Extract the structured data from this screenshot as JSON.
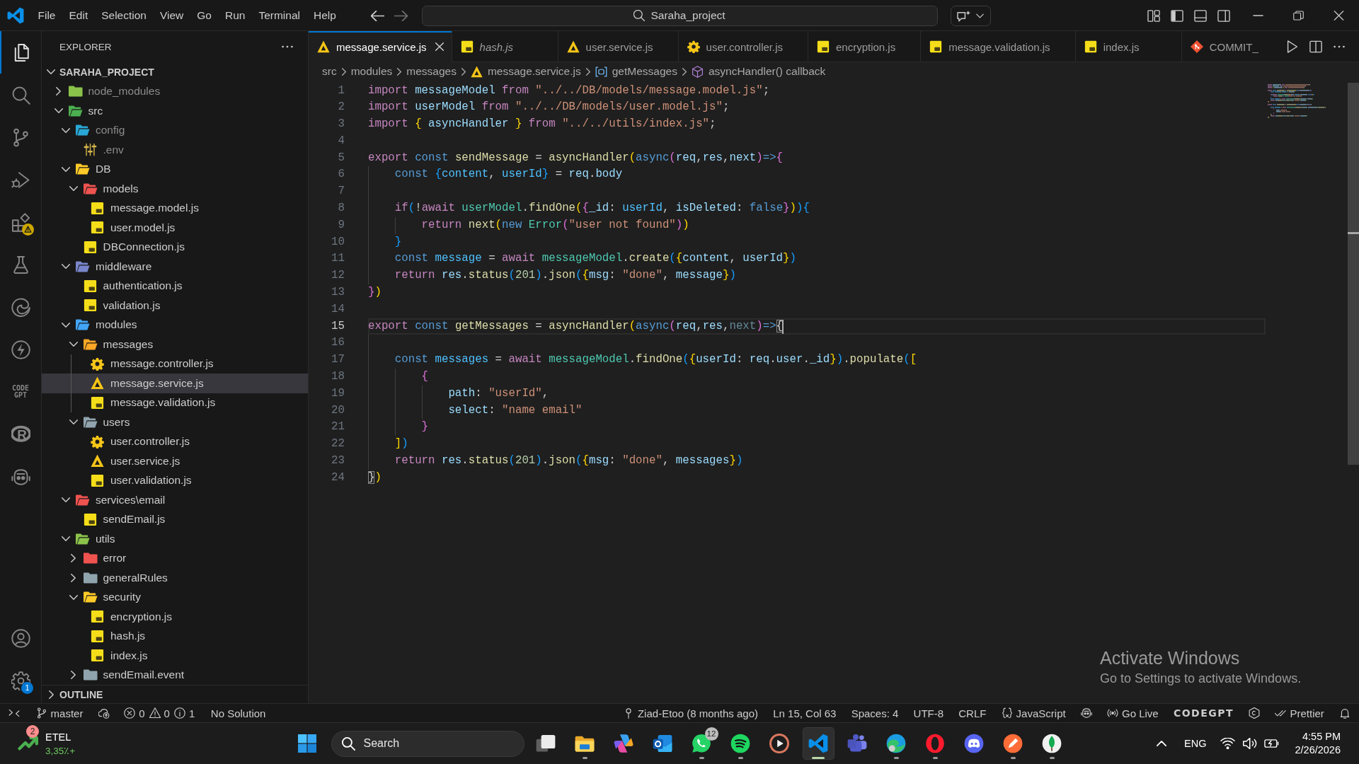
{
  "title_bar": {
    "menu": [
      "File",
      "Edit",
      "Selection",
      "View",
      "Go",
      "Run",
      "Terminal",
      "Help"
    ],
    "command_center": "Saraha_project"
  },
  "activity_bar": {
    "items": [
      {
        "kind": "explorer",
        "selected": true,
        "warning": false
      },
      {
        "kind": "search",
        "selected": false,
        "warning": false
      },
      {
        "kind": "source-control",
        "selected": false,
        "warning": false
      },
      {
        "kind": "debug",
        "selected": false,
        "warning": false
      },
      {
        "kind": "extensions",
        "selected": false,
        "warning": true
      },
      {
        "kind": "testing",
        "selected": false,
        "warning": false
      },
      {
        "kind": "browser",
        "selected": false,
        "warning": false
      },
      {
        "kind": "lightning",
        "selected": false,
        "warning": false
      },
      {
        "kind": "text",
        "label": "CODE GPT",
        "selected": false,
        "warning": false
      },
      {
        "kind": "ring",
        "label": "R",
        "selected": false,
        "warning": false
      },
      {
        "kind": "robot",
        "selected": false,
        "warning": false
      }
    ],
    "bottom": [
      {
        "kind": "account"
      },
      {
        "kind": "settings",
        "badge": "1"
      }
    ]
  },
  "sidebar": {
    "title": "EXPLORER",
    "project": {
      "name": "SARAHA_PROJECT",
      "expanded": true,
      "children": [
        {
          "name": "node_modules",
          "kind": "folder",
          "color": "#8bc34a",
          "expanded": false,
          "dimmed": true,
          "selected": false
        },
        {
          "name": "src",
          "kind": "folder",
          "color": "#4caf50",
          "expanded": true,
          "dimmed": false,
          "selected": false,
          "children": [
            {
              "name": "config",
              "kind": "folder",
              "color": "#29a8d6",
              "expanded": true,
              "dimmed": true,
              "selected": false,
              "children": [
                {
                  "name": ".env",
                  "kind": "env",
                  "dimmed": true,
                  "selected": false
                }
              ]
            },
            {
              "name": "DB",
              "kind": "folder",
              "color": "#ffca28",
              "expanded": true,
              "dimmed": false,
              "selected": false,
              "children": [
                {
                  "name": "models",
                  "kind": "folder",
                  "color": "#ef5350",
                  "expanded": true,
                  "dimmed": false,
                  "selected": false,
                  "children": [
                    {
                      "name": "message.model.js",
                      "kind": "js",
                      "dimmed": false,
                      "selected": false
                    },
                    {
                      "name": "user.model.js",
                      "kind": "js",
                      "dimmed": false,
                      "selected": false
                    }
                  ]
                },
                {
                  "name": "DBConnection.js",
                  "kind": "js",
                  "dimmed": false,
                  "selected": false
                }
              ]
            },
            {
              "name": "middleware",
              "kind": "folder",
              "color": "#7986cb",
              "expanded": true,
              "dimmed": false,
              "selected": false,
              "children": [
                {
                  "name": "authentication.js",
                  "kind": "js",
                  "dimmed": false,
                  "selected": false
                },
                {
                  "name": "validation.js",
                  "kind": "js",
                  "dimmed": false,
                  "selected": false
                }
              ]
            },
            {
              "name": "modules",
              "kind": "folder",
              "color": "#42a5f5",
              "expanded": true,
              "dimmed": false,
              "selected": false,
              "children": [
                {
                  "name": "messages",
                  "kind": "folder",
                  "color": "#ffa726",
                  "expanded": true,
                  "dimmed": false,
                  "selected": false,
                  "children": [
                    {
                      "name": "message.controller.js",
                      "kind": "controller",
                      "dimmed": false,
                      "selected": false
                    },
                    {
                      "name": "message.service.js",
                      "kind": "service",
                      "dimmed": false,
                      "selected": true
                    },
                    {
                      "name": "message.validation.js",
                      "kind": "js",
                      "dimmed": false,
                      "selected": false
                    }
                  ]
                },
                {
                  "name": "users",
                  "kind": "folder",
                  "color": "#90a4ae",
                  "expanded": true,
                  "dimmed": false,
                  "selected": false,
                  "children": [
                    {
                      "name": "user.controller.js",
                      "kind": "controller",
                      "dimmed": false,
                      "selected": false
                    },
                    {
                      "name": "user.service.js",
                      "kind": "service",
                      "dimmed": false,
                      "selected": false
                    },
                    {
                      "name": "user.validation.js",
                      "kind": "js",
                      "dimmed": false,
                      "selected": false
                    }
                  ]
                }
              ]
            },
            {
              "name": "services\\email",
              "kind": "folder",
              "color": "#ef5350",
              "expanded": true,
              "dimmed": false,
              "selected": false,
              "children": [
                {
                  "name": "sendEmail.js",
                  "kind": "js",
                  "dimmed": false,
                  "selected": false
                }
              ]
            },
            {
              "name": "utils",
              "kind": "folder",
              "color": "#8bc34a",
              "expanded": true,
              "dimmed": false,
              "selected": false,
              "children": [
                {
                  "name": "error",
                  "kind": "folder",
                  "color": "#ef5350",
                  "expanded": false,
                  "dimmed": false,
                  "selected": false
                },
                {
                  "name": "generalRules",
                  "kind": "folder",
                  "color": "#90a4ae",
                  "expanded": false,
                  "dimmed": false,
                  "selected": false
                },
                {
                  "name": "security",
                  "kind": "folder",
                  "color": "#ffca28",
                  "expanded": true,
                  "dimmed": false,
                  "selected": false,
                  "children": [
                    {
                      "name": "encryption.js",
                      "kind": "js",
                      "dimmed": false,
                      "selected": false
                    },
                    {
                      "name": "hash.js",
                      "kind": "js",
                      "dimmed": false,
                      "selected": false
                    },
                    {
                      "name": "index.js",
                      "kind": "js",
                      "dimmed": false,
                      "selected": false
                    }
                  ]
                },
                {
                  "name": "sendEmail.event",
                  "kind": "folder",
                  "color": "#90a4ae",
                  "expanded": false,
                  "dimmed": false,
                  "selected": false
                }
              ]
            }
          ]
        }
      ]
    },
    "outline": {
      "title": "OUTLINE",
      "expanded": false
    }
  },
  "editor": {
    "tabs": [
      {
        "label": "message.service.js",
        "kind": "service",
        "selected": true,
        "preview": false
      },
      {
        "label": "hash.js",
        "kind": "js",
        "selected": false,
        "preview": true
      },
      {
        "label": "user.service.js",
        "kind": "service",
        "selected": false,
        "preview": false
      },
      {
        "label": "user.controller.js",
        "kind": "controller",
        "selected": false,
        "preview": false
      },
      {
        "label": "encryption.js",
        "kind": "js",
        "selected": false,
        "preview": false
      },
      {
        "label": "message.validation.js",
        "kind": "js",
        "selected": false,
        "preview": false
      },
      {
        "label": "index.js",
        "kind": "js",
        "selected": false,
        "preview": false
      },
      {
        "label": "COMMIT_",
        "kind": "git",
        "selected": false,
        "preview": false
      }
    ],
    "breadcrumbs": [
      {
        "text": "src",
        "kind": "folder"
      },
      {
        "text": "modules",
        "kind": "folder"
      },
      {
        "text": "messages",
        "kind": "folder"
      },
      {
        "text": "message.service.js",
        "kind": "service"
      },
      {
        "text": "getMessages",
        "kind": "variable"
      },
      {
        "text": "asyncHandler() callback",
        "kind": "method"
      }
    ],
    "lines": [
      {
        "number": "1",
        "active": false,
        "tokens": [
          {
            "text": "import ",
            "kind": "keyword"
          },
          {
            "text": "messageModel",
            "kind": "variable"
          },
          {
            "text": " from ",
            "kind": "keyword"
          },
          {
            "text": "\"../../DB/models/message.model.js\"",
            "kind": "string"
          },
          {
            "text": ";",
            "kind": "plain"
          }
        ]
      },
      {
        "number": "2",
        "active": false,
        "tokens": [
          {
            "text": "import ",
            "kind": "keyword"
          },
          {
            "text": "userModel",
            "kind": "variable"
          },
          {
            "text": " from ",
            "kind": "keyword"
          },
          {
            "text": "\"../../DB/models/user.model.js\"",
            "kind": "string"
          },
          {
            "text": ";",
            "kind": "plain"
          }
        ]
      },
      {
        "number": "3",
        "active": false,
        "tokens": [
          {
            "text": "import ",
            "kind": "keyword"
          },
          {
            "text": "{",
            "kind": "bracket1"
          },
          {
            "text": " asyncHandler ",
            "kind": "variable"
          },
          {
            "text": "}",
            "kind": "bracket1"
          },
          {
            "text": " from ",
            "kind": "keyword"
          },
          {
            "text": "\"../../utils/index.js\"",
            "kind": "string"
          },
          {
            "text": ";",
            "kind": "plain"
          }
        ]
      },
      {
        "number": "4",
        "active": false
      },
      {
        "number": "5",
        "active": false,
        "tokens": [
          {
            "text": "export ",
            "kind": "keyword"
          },
          {
            "text": "const ",
            "kind": "storage"
          },
          {
            "text": "sendMessage",
            "kind": "function"
          },
          {
            "text": " = ",
            "kind": "plain"
          },
          {
            "text": "asyncHandler",
            "kind": "function"
          },
          {
            "text": "(",
            "kind": "bracket1"
          },
          {
            "text": "async",
            "kind": "storage"
          },
          {
            "text": "(",
            "kind": "bracket2"
          },
          {
            "text": "req",
            "kind": "variable"
          },
          {
            "text": ",",
            "kind": "plain"
          },
          {
            "text": "res",
            "kind": "variable"
          },
          {
            "text": ",",
            "kind": "plain"
          },
          {
            "text": "next",
            "kind": "variable"
          },
          {
            "text": ")",
            "kind": "bracket2"
          },
          {
            "text": "=>",
            "kind": "storage"
          },
          {
            "text": "{",
            "kind": "bracket2"
          }
        ]
      },
      {
        "number": "6",
        "active": false,
        "tokens": [
          {
            "text": "    const ",
            "kind": "storage"
          },
          {
            "text": "{",
            "kind": "bracket3"
          },
          {
            "text": "content",
            "kind": "constant"
          },
          {
            "text": ", ",
            "kind": "plain"
          },
          {
            "text": "userId",
            "kind": "constant"
          },
          {
            "text": "}",
            "kind": "bracket3"
          },
          {
            "text": " = ",
            "kind": "plain"
          },
          {
            "text": "req",
            "kind": "variable"
          },
          {
            "text": ".",
            "kind": "plain"
          },
          {
            "text": "body",
            "kind": "variable"
          }
        ]
      },
      {
        "number": "7",
        "active": false
      },
      {
        "number": "8",
        "active": false,
        "tokens": [
          {
            "text": "    if",
            "kind": "keyword"
          },
          {
            "text": "(",
            "kind": "bracket3"
          },
          {
            "text": "!",
            "kind": "plain"
          },
          {
            "text": "await ",
            "kind": "keyword"
          },
          {
            "text": "userModel",
            "kind": "type"
          },
          {
            "text": ".",
            "kind": "plain"
          },
          {
            "text": "findOne",
            "kind": "function"
          },
          {
            "text": "(",
            "kind": "bracket1"
          },
          {
            "text": "{",
            "kind": "bracket2"
          },
          {
            "text": "_id",
            "kind": "variable"
          },
          {
            "text": ": ",
            "kind": "plain"
          },
          {
            "text": "userId",
            "kind": "constant"
          },
          {
            "text": ", ",
            "kind": "plain"
          },
          {
            "text": "isDeleted",
            "kind": "variable"
          },
          {
            "text": ": ",
            "kind": "plain"
          },
          {
            "text": "false",
            "kind": "storage"
          },
          {
            "text": "}",
            "kind": "bracket2"
          },
          {
            "text": ")",
            "kind": "bracket1"
          },
          {
            "text": ")",
            "kind": "bracket3"
          },
          {
            "text": "{",
            "kind": "bracket3"
          }
        ]
      },
      {
        "number": "9",
        "active": false,
        "tokens": [
          {
            "text": "        return ",
            "kind": "keyword"
          },
          {
            "text": "next",
            "kind": "function"
          },
          {
            "text": "(",
            "kind": "bracket1"
          },
          {
            "text": "new ",
            "kind": "storage"
          },
          {
            "text": "Error",
            "kind": "type"
          },
          {
            "text": "(",
            "kind": "bracket2"
          },
          {
            "text": "\"user not found\"",
            "kind": "string"
          },
          {
            "text": ")",
            "kind": "bracket2"
          },
          {
            "text": ")",
            "kind": "bracket1"
          }
        ]
      },
      {
        "number": "10",
        "active": false,
        "tokens": [
          {
            "text": "    }",
            "kind": "bracket3"
          }
        ]
      },
      {
        "number": "11",
        "active": false,
        "tokens": [
          {
            "text": "    const ",
            "kind": "storage"
          },
          {
            "text": "message",
            "kind": "constant"
          },
          {
            "text": " = ",
            "kind": "plain"
          },
          {
            "text": "await ",
            "kind": "keyword"
          },
          {
            "text": "messageModel",
            "kind": "type"
          },
          {
            "text": ".",
            "kind": "plain"
          },
          {
            "text": "create",
            "kind": "function"
          },
          {
            "text": "(",
            "kind": "bracket3"
          },
          {
            "text": "{",
            "kind": "bracket1"
          },
          {
            "text": "content",
            "kind": "variable"
          },
          {
            "text": ", ",
            "kind": "plain"
          },
          {
            "text": "userId",
            "kind": "variable"
          },
          {
            "text": "}",
            "kind": "bracket1"
          },
          {
            "text": ")",
            "kind": "bracket3"
          }
        ]
      },
      {
        "number": "12",
        "active": false,
        "tokens": [
          {
            "text": "    return ",
            "kind": "keyword"
          },
          {
            "text": "res",
            "kind": "variable"
          },
          {
            "text": ".",
            "kind": "plain"
          },
          {
            "text": "status",
            "kind": "function"
          },
          {
            "text": "(",
            "kind": "bracket3"
          },
          {
            "text": "201",
            "kind": "number"
          },
          {
            "text": ")",
            "kind": "bracket3"
          },
          {
            "text": ".",
            "kind": "plain"
          },
          {
            "text": "json",
            "kind": "function"
          },
          {
            "text": "(",
            "kind": "bracket3"
          },
          {
            "text": "{",
            "kind": "bracket1"
          },
          {
            "text": "msg",
            "kind": "variable"
          },
          {
            "text": ": ",
            "kind": "plain"
          },
          {
            "text": "\"done\"",
            "kind": "string"
          },
          {
            "text": ", ",
            "kind": "plain"
          },
          {
            "text": "message",
            "kind": "variable"
          },
          {
            "text": "}",
            "kind": "bracket1"
          },
          {
            "text": ")",
            "kind": "bracket3"
          }
        ]
      },
      {
        "number": "13",
        "active": false,
        "tokens": [
          {
            "text": "}",
            "kind": "bracket2"
          },
          {
            "text": ")",
            "kind": "bracket1"
          }
        ]
      },
      {
        "number": "14",
        "active": false
      },
      {
        "number": "15",
        "active": true,
        "tokens": [
          {
            "text": "export ",
            "kind": "keyword"
          },
          {
            "text": "const ",
            "kind": "storage"
          },
          {
            "text": "getMessages",
            "kind": "function"
          },
          {
            "text": " = ",
            "kind": "plain"
          },
          {
            "text": "asyncHandler",
            "kind": "function"
          },
          {
            "text": "(",
            "kind": "bracket1"
          },
          {
            "text": "async",
            "kind": "storage"
          },
          {
            "text": "(",
            "kind": "bracket2"
          },
          {
            "text": "req",
            "kind": "variable"
          },
          {
            "text": ",",
            "kind": "plain"
          },
          {
            "text": "res",
            "kind": "variable"
          },
          {
            "text": ",",
            "kind": "plain"
          },
          {
            "text": "next",
            "kind": "unused"
          },
          {
            "text": ")",
            "kind": "bracket2"
          },
          {
            "text": "=>",
            "kind": "storage"
          },
          {
            "text": "{",
            "kind": "match"
          }
        ]
      },
      {
        "number": "16",
        "active": false
      },
      {
        "number": "17",
        "active": false,
        "tokens": [
          {
            "text": "    const ",
            "kind": "storage"
          },
          {
            "text": "messages",
            "kind": "constant"
          },
          {
            "text": " = ",
            "kind": "plain"
          },
          {
            "text": "await ",
            "kind": "keyword"
          },
          {
            "text": "messageModel",
            "kind": "type"
          },
          {
            "text": ".",
            "kind": "plain"
          },
          {
            "text": "findOne",
            "kind": "function"
          },
          {
            "text": "(",
            "kind": "bracket3"
          },
          {
            "text": "{",
            "kind": "bracket1"
          },
          {
            "text": "userId",
            "kind": "variable"
          },
          {
            "text": ": ",
            "kind": "plain"
          },
          {
            "text": "req",
            "kind": "variable"
          },
          {
            "text": ".",
            "kind": "plain"
          },
          {
            "text": "user",
            "kind": "variable"
          },
          {
            "text": ".",
            "kind": "plain"
          },
          {
            "text": "_id",
            "kind": "variable"
          },
          {
            "text": "}",
            "kind": "bracket1"
          },
          {
            "text": ")",
            "kind": "bracket3"
          },
          {
            "text": ".",
            "kind": "plain"
          },
          {
            "text": "populate",
            "kind": "function"
          },
          {
            "text": "(",
            "kind": "bracket3"
          },
          {
            "text": "[",
            "kind": "bracket1"
          }
        ]
      },
      {
        "number": "18",
        "active": false,
        "tokens": [
          {
            "text": "        {",
            "kind": "bracket2"
          }
        ]
      },
      {
        "number": "19",
        "active": false,
        "tokens": [
          {
            "text": "            path",
            "kind": "variable"
          },
          {
            "text": ": ",
            "kind": "plain"
          },
          {
            "text": "\"userId\"",
            "kind": "string"
          },
          {
            "text": ",",
            "kind": "plain"
          }
        ]
      },
      {
        "number": "20",
        "active": false,
        "tokens": [
          {
            "text": "            select",
            "kind": "variable"
          },
          {
            "text": ": ",
            "kind": "plain"
          },
          {
            "text": "\"name email\"",
            "kind": "string"
          }
        ]
      },
      {
        "number": "21",
        "active": false,
        "tokens": [
          {
            "text": "        }",
            "kind": "bracket2"
          }
        ]
      },
      {
        "number": "22",
        "active": false,
        "tokens": [
          {
            "text": "    ]",
            "kind": "bracket1"
          },
          {
            "text": ")",
            "kind": "bracket3"
          }
        ]
      },
      {
        "number": "23",
        "active": false,
        "tokens": [
          {
            "text": "    return ",
            "kind": "keyword"
          },
          {
            "text": "res",
            "kind": "variable"
          },
          {
            "text": ".",
            "kind": "plain"
          },
          {
            "text": "status",
            "kind": "function"
          },
          {
            "text": "(",
            "kind": "bracket3"
          },
          {
            "text": "201",
            "kind": "number"
          },
          {
            "text": ")",
            "kind": "bracket3"
          },
          {
            "text": ".",
            "kind": "plain"
          },
          {
            "text": "json",
            "kind": "function"
          },
          {
            "text": "(",
            "kind": "bracket3"
          },
          {
            "text": "{",
            "kind": "bracket1"
          },
          {
            "text": "msg",
            "kind": "variable"
          },
          {
            "text": ": ",
            "kind": "plain"
          },
          {
            "text": "\"done\"",
            "kind": "string"
          },
          {
            "text": ", ",
            "kind": "plain"
          },
          {
            "text": "messages",
            "kind": "variable"
          },
          {
            "text": "}",
            "kind": "bracket1"
          },
          {
            "text": ")",
            "kind": "bracket3"
          }
        ]
      },
      {
        "number": "24",
        "active": false,
        "tokens": [
          {
            "text": "}",
            "kind": "match"
          },
          {
            "text": ")",
            "kind": "bracket1"
          }
        ]
      }
    ]
  },
  "activation_notice": {
    "title": "Activate Windows",
    "text": "Go to Settings to activate Windows."
  },
  "status_bar": {
    "left": [
      {
        "kind": "remote"
      },
      {
        "kind": "branch",
        "text": "master"
      },
      {
        "kind": "sync"
      },
      {
        "kind": "errors",
        "text": "0"
      },
      {
        "kind": "warnings",
        "text": "0"
      },
      {
        "kind": "info",
        "text": "1"
      },
      {
        "kind": "plain",
        "text": "No Solution"
      }
    ],
    "right": [
      {
        "kind": "blame",
        "text": "Ziad-Etoo (8 months ago)"
      },
      {
        "kind": "plain",
        "text": "Ln 15, Col 63"
      },
      {
        "kind": "plain",
        "text": "Spaces: 4"
      },
      {
        "kind": "plain",
        "text": "UTF-8"
      },
      {
        "kind": "plain",
        "text": "CRLF"
      },
      {
        "kind": "language",
        "text": "JavaScript"
      },
      {
        "kind": "copilot"
      },
      {
        "kind": "live",
        "text": "Go Live"
      },
      {
        "kind": "logo",
        "text": "CODEGPT"
      },
      {
        "kind": "csharp"
      },
      {
        "kind": "prettier",
        "text": "Prettier"
      },
      {
        "kind": "notifications"
      }
    ]
  },
  "taskbar": {
    "widget": {
      "badge": "2",
      "symbol": "ETEL",
      "change": "3,35٪+"
    },
    "search": {
      "label": "Search"
    },
    "apps": [
      {
        "kind": "taskview",
        "running": false,
        "selected": false
      },
      {
        "kind": "files",
        "running": true,
        "selected": false
      },
      {
        "kind": "assistant",
        "running": false,
        "selected": false
      },
      {
        "kind": "mail",
        "running": false,
        "selected": false
      },
      {
        "kind": "messenger",
        "running": true,
        "selected": false,
        "badge": "12"
      },
      {
        "kind": "music",
        "running": true,
        "selected": false
      },
      {
        "kind": "media",
        "running": false,
        "selected": false
      },
      {
        "kind": "editor",
        "running": true,
        "selected": true
      },
      {
        "kind": "meeting",
        "running": false,
        "selected": false
      },
      {
        "kind": "browser",
        "running": true,
        "selected": false
      },
      {
        "kind": "opera",
        "running": true,
        "selected": false
      },
      {
        "kind": "discord",
        "running": false,
        "selected": false
      },
      {
        "kind": "api",
        "running": true,
        "selected": false
      },
      {
        "kind": "database",
        "running": true,
        "selected": false
      }
    ],
    "tray": {
      "language": "ENG",
      "time": "4:55 PM",
      "date": "2/26/2026"
    }
  }
}
